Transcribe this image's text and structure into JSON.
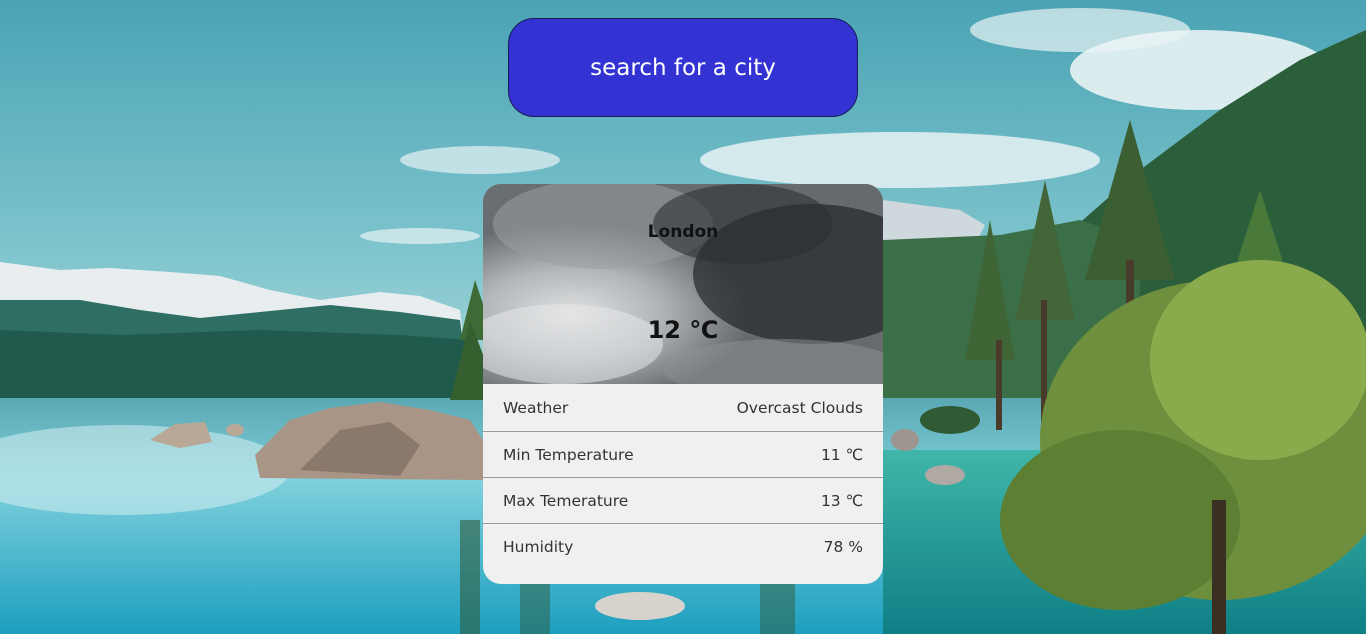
{
  "search": {
    "label": "search for a city"
  },
  "weather": {
    "city": "London",
    "temperature": "12 ℃",
    "details": [
      {
        "label": "Weather",
        "value": "Overcast Clouds"
      },
      {
        "label": "Min Temperature",
        "value": "11 ℃"
      },
      {
        "label": "Max Temerature",
        "value": "13 ℃"
      },
      {
        "label": "Humidity",
        "value": "78 %"
      }
    ]
  },
  "colors": {
    "search_button": "#3333d4",
    "card_background": "#f0f0f0"
  }
}
